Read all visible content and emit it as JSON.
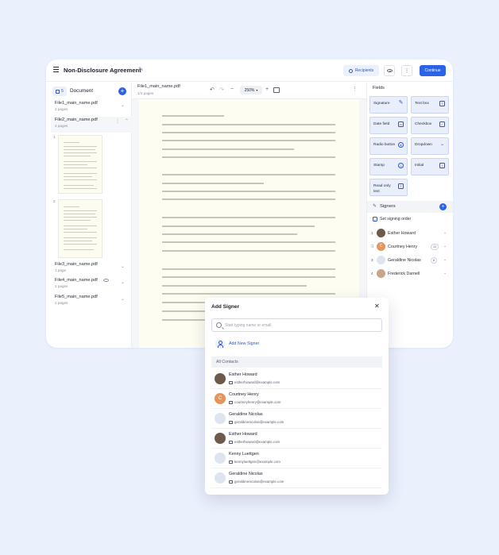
{
  "header": {
    "title": "Non-Disclosure Agreement",
    "recipients_label": "Recipients",
    "more_label": "⋮",
    "continue_label": "Continue"
  },
  "left": {
    "count_badge": "5",
    "documents_label": "Document",
    "files": [
      {
        "name": "File1_main_name.pdf",
        "pages": "2 pages"
      },
      {
        "name": "File2_main_name.pdf",
        "pages": "4 pages"
      },
      {
        "name": "File3_main_name.pdf",
        "pages": "1 page"
      },
      {
        "name": "File4_main_name.pdf",
        "pages": "2 pages"
      },
      {
        "name": "File5_main_name.pdf",
        "pages": "2 pages"
      }
    ],
    "thumb_numbers": [
      "1",
      "2"
    ]
  },
  "center": {
    "file_name": "File1_main_name.pdf",
    "page_info": "1/4 pages",
    "zoom": "250%"
  },
  "fields": {
    "title": "Fields",
    "items": [
      {
        "label": "Signature",
        "icon": "pen-icon"
      },
      {
        "label": "Text box",
        "icon": "text-box-icon"
      },
      {
        "label": "Date field",
        "icon": "calendar-icon"
      },
      {
        "label": "Checkbox",
        "icon": "checkbox-icon"
      },
      {
        "label": "Radio button",
        "icon": "radio-icon"
      },
      {
        "label": "Dropdown",
        "icon": "chevron-down-icon"
      },
      {
        "label": "Stamp",
        "icon": "stamp-icon"
      },
      {
        "label": "Initial",
        "icon": "initial-icon"
      },
      {
        "label": "Read only text",
        "icon": "read-only-icon"
      }
    ]
  },
  "signers": {
    "title": "Signers",
    "order_label": "Set signing order",
    "list": [
      {
        "num": "1",
        "name": "Esther Howard",
        "count": ""
      },
      {
        "num": "2",
        "name": "Courtney Henry",
        "count": "12",
        "initial": "C"
      },
      {
        "num": "3",
        "name": "Geraldine Nicolas",
        "count": "8"
      },
      {
        "num": "4",
        "name": "Frederick Darnell",
        "count": ""
      }
    ]
  },
  "modal": {
    "title": "Add Signer",
    "search_placeholder": "Start typing name or email",
    "add_new_label": "Add New Signer",
    "all_contacts_label": "All Contacts",
    "contacts": [
      {
        "name": "Esther Howard",
        "email": "estherhoward@example.com"
      },
      {
        "name": "Courtney Henry",
        "email": "courtneyhenry@example.com",
        "initial": "C"
      },
      {
        "name": "Geraldine Nicolas",
        "email": "geraldinenicolas@example.com"
      },
      {
        "name": "Esther Howard",
        "email": "estherhoward@example.com"
      },
      {
        "name": "Kenny Luettgen",
        "email": "kennyluettgen@example.com"
      },
      {
        "name": "Geraldine Nicolas",
        "email": "geraldinenicolas@example.com"
      }
    ]
  },
  "colors": {
    "accent": "#2b63e6",
    "background": "#eaf0fc",
    "page": "#fefdf1",
    "field_bg": "#e8eefc"
  }
}
